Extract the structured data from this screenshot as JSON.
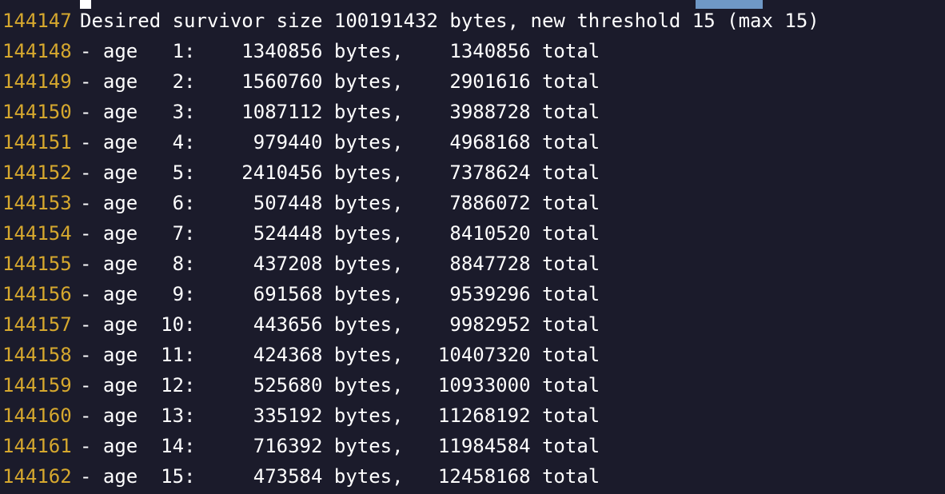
{
  "terminal": {
    "colors": {
      "background": "#1b1b2b",
      "line_number": "#d6a82e",
      "text": "#ffffff",
      "selection": "#6f98c6"
    },
    "lines": [
      {
        "number": "144147",
        "text": "Desired survivor size 100191432 bytes, new threshold 15 (max 15)"
      },
      {
        "number": "144148",
        "text": "- age   1:    1340856 bytes,    1340856 total"
      },
      {
        "number": "144149",
        "text": "- age   2:    1560760 bytes,    2901616 total"
      },
      {
        "number": "144150",
        "text": "- age   3:    1087112 bytes,    3988728 total"
      },
      {
        "number": "144151",
        "text": "- age   4:     979440 bytes,    4968168 total"
      },
      {
        "number": "144152",
        "text": "- age   5:    2410456 bytes,    7378624 total"
      },
      {
        "number": "144153",
        "text": "- age   6:     507448 bytes,    7886072 total"
      },
      {
        "number": "144154",
        "text": "- age   7:     524448 bytes,    8410520 total"
      },
      {
        "number": "144155",
        "text": "- age   8:     437208 bytes,    8847728 total"
      },
      {
        "number": "144156",
        "text": "- age   9:     691568 bytes,    9539296 total"
      },
      {
        "number": "144157",
        "text": "- age  10:     443656 bytes,    9982952 total"
      },
      {
        "number": "144158",
        "text": "- age  11:     424368 bytes,   10407320 total"
      },
      {
        "number": "144159",
        "text": "- age  12:     525680 bytes,   10933000 total"
      },
      {
        "number": "144160",
        "text": "- age  13:     335192 bytes,   11268192 total"
      },
      {
        "number": "144161",
        "text": "- age  14:     716392 bytes,   11984584 total"
      },
      {
        "number": "144162",
        "text": "- age  15:     473584 bytes,   12458168 total"
      }
    ]
  }
}
